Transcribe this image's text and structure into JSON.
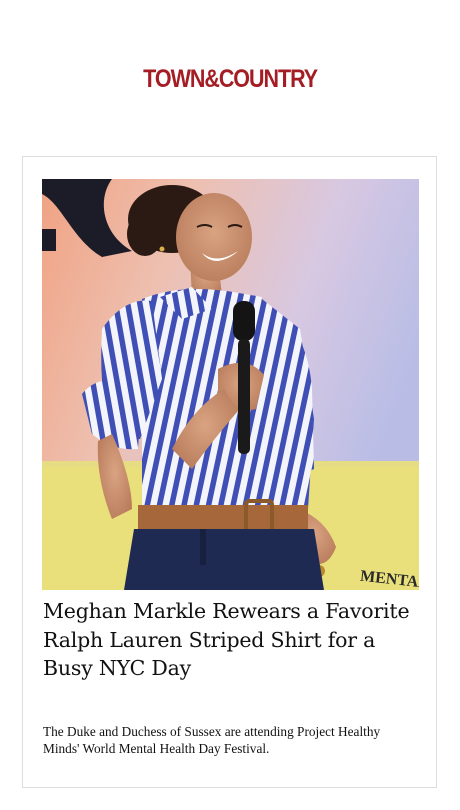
{
  "header": {
    "logo_text": "TOWN&COUNTRY",
    "brand_color": "#a51d24"
  },
  "article": {
    "headline": "Meghan Markle Rewears a Favorite Ralph Lauren Striped Shirt for a Busy NYC Day",
    "dek": "The Duke and Duchess of Sussex are attending Project Healthy Minds' World Mental Health Day Festival.",
    "image_icon": "article-photo"
  }
}
